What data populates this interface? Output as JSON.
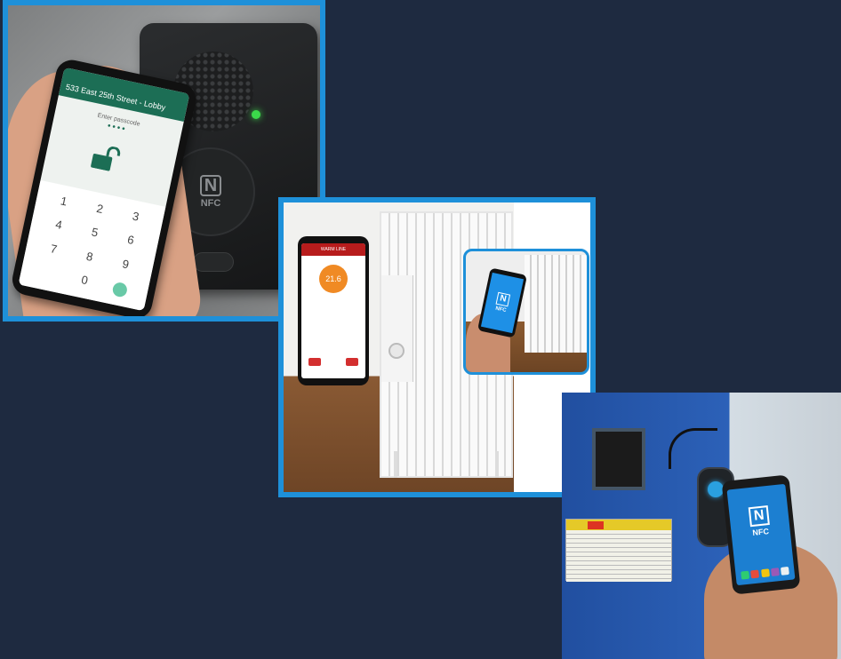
{
  "photo_1": {
    "phone_header": "533 East 25th Street - Lobby",
    "prompt": "Enter passcode",
    "passcode_dots": "••••",
    "keypad": [
      "1",
      "2",
      "3",
      "4",
      "5",
      "6",
      "7",
      "8",
      "9",
      "",
      "0",
      ""
    ],
    "reader_logo_text": "NFC",
    "reader_logo_mark": "N"
  },
  "photo_2": {
    "app_header": "WARM LINE",
    "temperature": "21.6",
    "inset_logo_text": "NFC",
    "inset_logo_mark": "N"
  },
  "photo_3": {
    "phone_logo_text": "NFC",
    "phone_logo_mark": "N"
  },
  "colors": {
    "background": "#1e2a40",
    "frame_accent": "#1e90d9",
    "nfc_blue": "#1c7fd1",
    "unlock_green": "#1c6e55"
  },
  "icons": [
    "unlock-icon",
    "nfc-logo-icon"
  ]
}
